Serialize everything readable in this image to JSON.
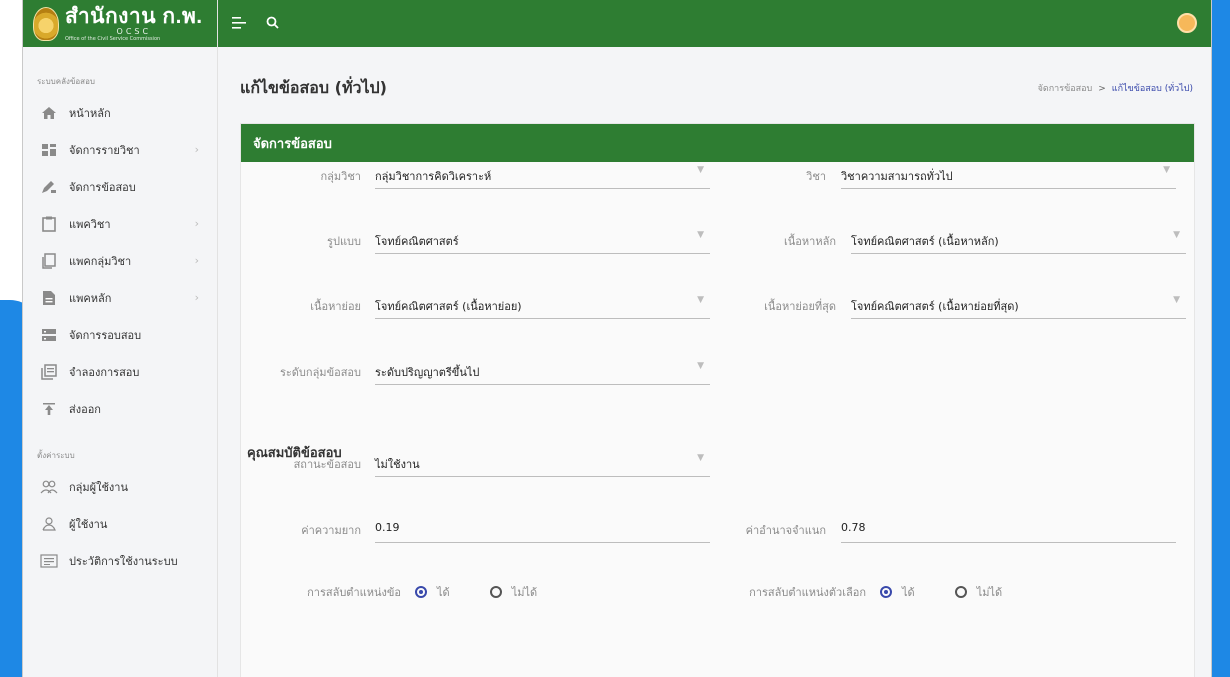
{
  "brand": {
    "title": "สำนักงาน ก.พ.",
    "ocsc": "OCSC",
    "subtitle": "Office of the Civil Service Commission"
  },
  "sidebar": {
    "section1": "ระบบคลังข้อสอบ",
    "section2": "ตั้งค่าระบบ",
    "items": [
      {
        "label": "หน้าหลัก",
        "icon": "home-icon",
        "chevron": false
      },
      {
        "label": "จัดการรายวิชา",
        "icon": "grid-icon",
        "chevron": true
      },
      {
        "label": "จัดการข้อสอบ",
        "icon": "edit-icon",
        "chevron": false
      },
      {
        "label": "แพควิชา",
        "icon": "clipboard-icon",
        "chevron": true
      },
      {
        "label": "แพคกลุ่มวิชา",
        "icon": "copy-icon",
        "chevron": true
      },
      {
        "label": "แพคหลัก",
        "icon": "file-icon",
        "chevron": true
      },
      {
        "label": "จัดการรอบสอบ",
        "icon": "server-icon",
        "chevron": false
      },
      {
        "label": "จำลองการสอบ",
        "icon": "library-icon",
        "chevron": false
      },
      {
        "label": "ส่งออก",
        "icon": "export-icon",
        "chevron": false
      }
    ],
    "settings": [
      {
        "label": "กลุ่มผู้ใช้งาน",
        "icon": "users-icon"
      },
      {
        "label": "ผู้ใช้งาน",
        "icon": "user-icon"
      },
      {
        "label": "ประวัติการใช้งานระบบ",
        "icon": "history-icon"
      }
    ]
  },
  "page": {
    "title": "แก้ไขข้อสอบ (ทั่วไป)",
    "breadcrumb_parent": "จัดการข้อสอบ",
    "breadcrumb_sep": ">",
    "breadcrumb_current": "แก้ไขข้อสอบ (ทั่วไป)"
  },
  "card": {
    "title": "จัดการข้อสอบ",
    "fields": {
      "subject_group": {
        "label": "กลุ่มวิชา",
        "value": "กลุ่มวิชาการคิดวิเคราะห์"
      },
      "subject": {
        "label": "วิชา",
        "value": "วิชาความสามารถทั่วไป"
      },
      "format": {
        "label": "รูปแบบ",
        "value": "โจทย์คณิตศาสตร์"
      },
      "main_content": {
        "label": "เนื้อหาหลัก",
        "value": "โจทย์คณิตศาสตร์ (เนื้อหาหลัก)"
      },
      "sub_content": {
        "label": "เนื้อหาย่อย",
        "value": "โจทย์คณิตศาสตร์ (เนื้อหาย่อย)"
      },
      "smallest_content": {
        "label": "เนื้อหาย่อยที่สุด",
        "value": "โจทย์คณิตศาสตร์ (เนื้อหาย่อยที่สุด)"
      },
      "level": {
        "label": "ระดับกลุ่มข้อสอบ",
        "value": "ระดับปริญญาตรีขึ้นไป"
      }
    },
    "properties_title": "คุณสมบัติข้อสอบ",
    "status": {
      "label": "สถานะข้อสอบ",
      "value": "ไม่ใช้งาน"
    },
    "difficulty": {
      "label": "ค่าความยาก",
      "value": "0.19"
    },
    "discrimination": {
      "label": "ค่าอำนาจจำแนก",
      "value": "0.78"
    },
    "shuffle_question": {
      "label": "การสลับตำแหน่งข้อ",
      "yes": "ได้",
      "no": "ไม่ได้",
      "selected": "yes"
    },
    "shuffle_choice": {
      "label": "การสลับตำแหน่งตัวเลือก",
      "yes": "ได้",
      "no": "ไม่ได้",
      "selected": "yes"
    }
  },
  "colors": {
    "header": "#2e7d32",
    "accent": "#3949ab",
    "frame": "#1e88e5"
  }
}
